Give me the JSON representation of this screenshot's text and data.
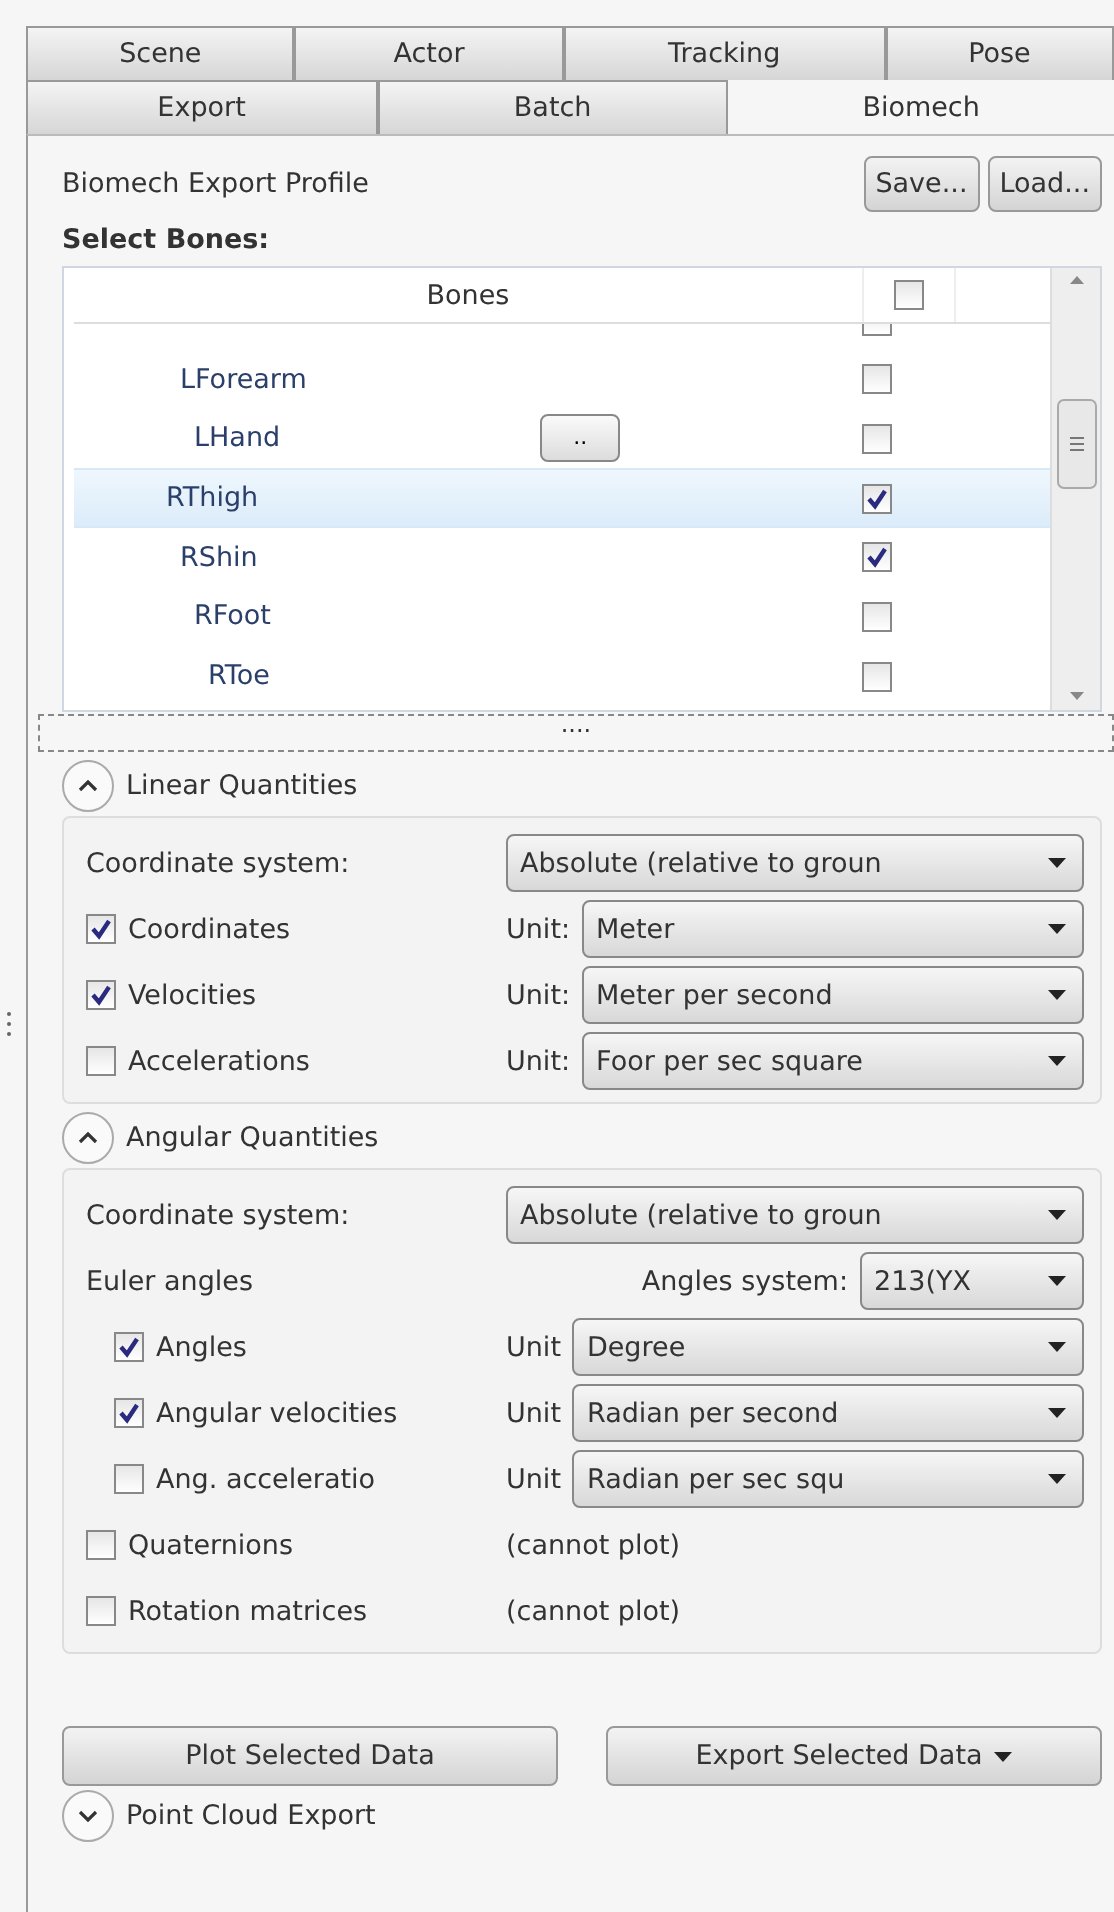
{
  "tabs": [
    [
      {
        "label": "Scene",
        "selected": false
      },
      {
        "label": "Actor",
        "selected": false
      },
      {
        "label": "Tracking",
        "selected": false
      },
      {
        "label": "Pose",
        "selected": false
      }
    ],
    [
      {
        "label": "Export",
        "selected": false
      },
      {
        "label": "Batch",
        "selected": false
      },
      {
        "label": "Biomech",
        "selected": true
      }
    ]
  ],
  "profile": {
    "label": "Biomech Export Profile",
    "buttons": [
      "Save...",
      "Load..."
    ]
  },
  "bones": {
    "heading": "Select Bones:",
    "column": "Bones",
    "all_checked": false,
    "splitter": "....",
    "items": [
      {
        "checked": false,
        "selected": false,
        "children": [
          {
            "name": "LForearm",
            "checked": false,
            "selected": false,
            "children": [
              {
                "name": "LHand",
                "checked": false,
                "selected": false,
                "button": ".."
              }
            ]
          }
        ]
      },
      {
        "name": "RThigh",
        "checked": true,
        "selected": true,
        "children": [
          {
            "name": "RShin",
            "checked": true,
            "selected": false,
            "children": [
              {
                "name": "RFoot",
                "checked": false,
                "selected": false,
                "children": [
                  {
                    "name": "RToe",
                    "checked": false,
                    "selected": false
                  }
                ]
              }
            ]
          }
        ]
      }
    ]
  },
  "sections": [
    {
      "title": "Linear Quantities",
      "expanded": true,
      "rows": [
        {
          "kind": "select",
          "label": "Coordinate system:",
          "value": "Absolute (relative to groun"
        },
        {
          "kind": "check",
          "label": "Coordinates",
          "checked": true,
          "unit_label": "Unit:",
          "value": "Meter"
        },
        {
          "kind": "check",
          "label": "Velocities",
          "checked": true,
          "unit_label": "Unit:",
          "value": "Meter per second"
        },
        {
          "kind": "check",
          "label": "Accelerations",
          "checked": false,
          "unit_label": "Unit:",
          "value": "Foor per sec square"
        }
      ]
    },
    {
      "title": "Angular Quantities",
      "expanded": true,
      "rows": [
        {
          "kind": "select",
          "label": "Coordinate system:",
          "value": "Absolute (relative to groun"
        },
        {
          "kind": "group",
          "label": "Euler angles",
          "select_label": "Angles system:",
          "value": "213(YX",
          "children": [
            {
              "kind": "check",
              "label": "Angles",
              "checked": true,
              "unit_label": "Unit",
              "value": "Degree"
            },
            {
              "kind": "check",
              "label": "Angular velocities",
              "checked": true,
              "unit_label": "Unit",
              "value": "Radian per second"
            },
            {
              "kind": "check",
              "label": "Ang. acceleratio",
              "checked": false,
              "unit_label": "Unit",
              "value": "Radian per sec squ"
            }
          ]
        },
        {
          "kind": "check",
          "label": "Quaternions",
          "checked": false,
          "note": "(cannot plot)"
        },
        {
          "kind": "check",
          "label": "Rotation matrices",
          "checked": false,
          "note": "(cannot plot)"
        }
      ]
    }
  ],
  "actions": [
    {
      "label": "Plot Selected Data",
      "dropdown": false
    },
    {
      "label": "Export Selected Data",
      "dropdown": true
    }
  ],
  "footer_section": {
    "title": "Point Cloud Export",
    "expanded": false
  }
}
